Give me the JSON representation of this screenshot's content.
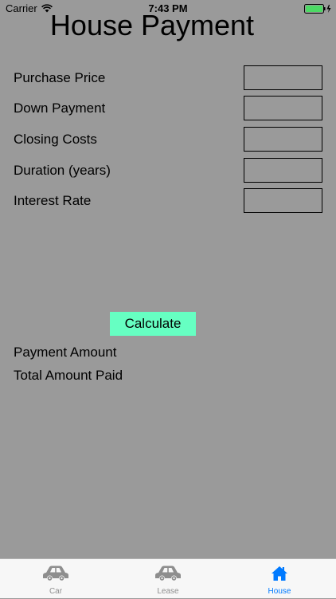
{
  "status_bar": {
    "carrier": "Carrier",
    "time": "7:43 PM"
  },
  "title": "House Payment",
  "form": {
    "fields": [
      {
        "label": "Purchase Price",
        "value": ""
      },
      {
        "label": "Down Payment",
        "value": ""
      },
      {
        "label": "Closing Costs",
        "value": ""
      },
      {
        "label": "Duration (years)",
        "value": ""
      },
      {
        "label": "Interest Rate",
        "value": ""
      }
    ]
  },
  "calculate_label": "Calculate",
  "results": {
    "payment_amount_label": "Payment Amount",
    "total_paid_label": "Total Amount Paid"
  },
  "tab_bar": {
    "tabs": [
      {
        "label": "Car",
        "icon": "car-icon",
        "active": false
      },
      {
        "label": "Lease",
        "icon": "car-icon",
        "active": false
      },
      {
        "label": "House",
        "icon": "home-icon",
        "active": true
      }
    ]
  },
  "colors": {
    "background": "#9a9a9a",
    "calculate_button": "#66ffc2",
    "active_tab": "#007aff",
    "inactive_tab": "#8e8e8e",
    "battery": "#4cd964"
  }
}
